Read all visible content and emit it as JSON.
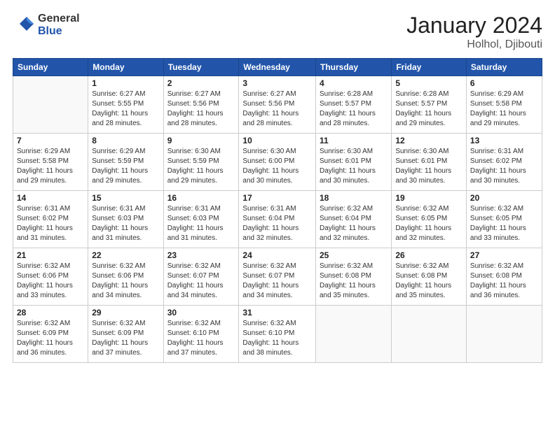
{
  "logo": {
    "general": "General",
    "blue": "Blue"
  },
  "header": {
    "month": "January 2024",
    "location": "Holhol, Djibouti"
  },
  "columns": [
    "Sunday",
    "Monday",
    "Tuesday",
    "Wednesday",
    "Thursday",
    "Friday",
    "Saturday"
  ],
  "weeks": [
    [
      {
        "num": "",
        "info": ""
      },
      {
        "num": "1",
        "info": "Sunrise: 6:27 AM\nSunset: 5:55 PM\nDaylight: 11 hours\nand 28 minutes."
      },
      {
        "num": "2",
        "info": "Sunrise: 6:27 AM\nSunset: 5:56 PM\nDaylight: 11 hours\nand 28 minutes."
      },
      {
        "num": "3",
        "info": "Sunrise: 6:27 AM\nSunset: 5:56 PM\nDaylight: 11 hours\nand 28 minutes."
      },
      {
        "num": "4",
        "info": "Sunrise: 6:28 AM\nSunset: 5:57 PM\nDaylight: 11 hours\nand 28 minutes."
      },
      {
        "num": "5",
        "info": "Sunrise: 6:28 AM\nSunset: 5:57 PM\nDaylight: 11 hours\nand 29 minutes."
      },
      {
        "num": "6",
        "info": "Sunrise: 6:29 AM\nSunset: 5:58 PM\nDaylight: 11 hours\nand 29 minutes."
      }
    ],
    [
      {
        "num": "7",
        "info": "Sunrise: 6:29 AM\nSunset: 5:58 PM\nDaylight: 11 hours\nand 29 minutes."
      },
      {
        "num": "8",
        "info": "Sunrise: 6:29 AM\nSunset: 5:59 PM\nDaylight: 11 hours\nand 29 minutes."
      },
      {
        "num": "9",
        "info": "Sunrise: 6:30 AM\nSunset: 5:59 PM\nDaylight: 11 hours\nand 29 minutes."
      },
      {
        "num": "10",
        "info": "Sunrise: 6:30 AM\nSunset: 6:00 PM\nDaylight: 11 hours\nand 30 minutes."
      },
      {
        "num": "11",
        "info": "Sunrise: 6:30 AM\nSunset: 6:01 PM\nDaylight: 11 hours\nand 30 minutes."
      },
      {
        "num": "12",
        "info": "Sunrise: 6:30 AM\nSunset: 6:01 PM\nDaylight: 11 hours\nand 30 minutes."
      },
      {
        "num": "13",
        "info": "Sunrise: 6:31 AM\nSunset: 6:02 PM\nDaylight: 11 hours\nand 30 minutes."
      }
    ],
    [
      {
        "num": "14",
        "info": "Sunrise: 6:31 AM\nSunset: 6:02 PM\nDaylight: 11 hours\nand 31 minutes."
      },
      {
        "num": "15",
        "info": "Sunrise: 6:31 AM\nSunset: 6:03 PM\nDaylight: 11 hours\nand 31 minutes."
      },
      {
        "num": "16",
        "info": "Sunrise: 6:31 AM\nSunset: 6:03 PM\nDaylight: 11 hours\nand 31 minutes."
      },
      {
        "num": "17",
        "info": "Sunrise: 6:31 AM\nSunset: 6:04 PM\nDaylight: 11 hours\nand 32 minutes."
      },
      {
        "num": "18",
        "info": "Sunrise: 6:32 AM\nSunset: 6:04 PM\nDaylight: 11 hours\nand 32 minutes."
      },
      {
        "num": "19",
        "info": "Sunrise: 6:32 AM\nSunset: 6:05 PM\nDaylight: 11 hours\nand 32 minutes."
      },
      {
        "num": "20",
        "info": "Sunrise: 6:32 AM\nSunset: 6:05 PM\nDaylight: 11 hours\nand 33 minutes."
      }
    ],
    [
      {
        "num": "21",
        "info": "Sunrise: 6:32 AM\nSunset: 6:06 PM\nDaylight: 11 hours\nand 33 minutes."
      },
      {
        "num": "22",
        "info": "Sunrise: 6:32 AM\nSunset: 6:06 PM\nDaylight: 11 hours\nand 34 minutes."
      },
      {
        "num": "23",
        "info": "Sunrise: 6:32 AM\nSunset: 6:07 PM\nDaylight: 11 hours\nand 34 minutes."
      },
      {
        "num": "24",
        "info": "Sunrise: 6:32 AM\nSunset: 6:07 PM\nDaylight: 11 hours\nand 34 minutes."
      },
      {
        "num": "25",
        "info": "Sunrise: 6:32 AM\nSunset: 6:08 PM\nDaylight: 11 hours\nand 35 minutes."
      },
      {
        "num": "26",
        "info": "Sunrise: 6:32 AM\nSunset: 6:08 PM\nDaylight: 11 hours\nand 35 minutes."
      },
      {
        "num": "27",
        "info": "Sunrise: 6:32 AM\nSunset: 6:08 PM\nDaylight: 11 hours\nand 36 minutes."
      }
    ],
    [
      {
        "num": "28",
        "info": "Sunrise: 6:32 AM\nSunset: 6:09 PM\nDaylight: 11 hours\nand 36 minutes."
      },
      {
        "num": "29",
        "info": "Sunrise: 6:32 AM\nSunset: 6:09 PM\nDaylight: 11 hours\nand 37 minutes."
      },
      {
        "num": "30",
        "info": "Sunrise: 6:32 AM\nSunset: 6:10 PM\nDaylight: 11 hours\nand 37 minutes."
      },
      {
        "num": "31",
        "info": "Sunrise: 6:32 AM\nSunset: 6:10 PM\nDaylight: 11 hours\nand 38 minutes."
      },
      {
        "num": "",
        "info": ""
      },
      {
        "num": "",
        "info": ""
      },
      {
        "num": "",
        "info": ""
      }
    ]
  ]
}
